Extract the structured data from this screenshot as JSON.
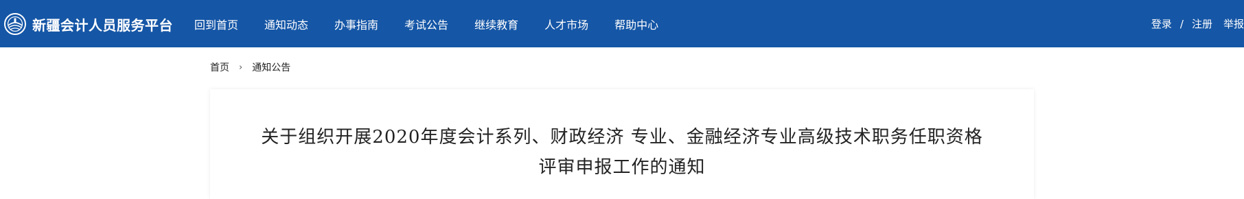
{
  "header": {
    "site_title": "新疆会计人员服务平台",
    "logo_icon": "emblem-icon",
    "bg_color": "#1556a6",
    "nav": [
      {
        "label": "回到首页"
      },
      {
        "label": "通知动态"
      },
      {
        "label": "办事指南"
      },
      {
        "label": "考试公告"
      },
      {
        "label": "继续教育"
      },
      {
        "label": "人才市场"
      },
      {
        "label": "帮助中心"
      }
    ],
    "user_links": {
      "login": "登录",
      "separator": "/",
      "register": "注册",
      "report": "举报"
    }
  },
  "breadcrumb": {
    "home": "首页",
    "separator": "›",
    "current": "通知公告"
  },
  "article": {
    "title": "关于组织开展2020年度会计系列、财政经济 专业、金融经济专业高级技术职务任职资格\n评审申报工作的通知"
  }
}
